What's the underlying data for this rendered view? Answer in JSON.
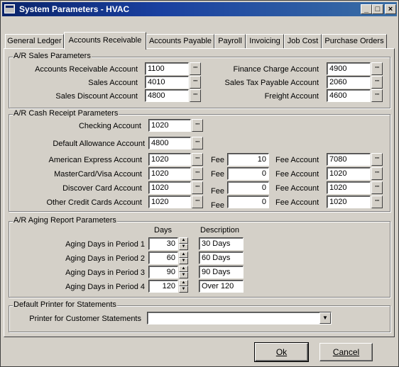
{
  "window": {
    "title": "System Parameters - HVAC",
    "min": "_",
    "max": "□",
    "close": "×"
  },
  "tabs": [
    "General Ledger",
    "Accounts Receivable",
    "Accounts Payable",
    "Payroll",
    "Invoicing",
    "Job Cost",
    "Purchase Orders"
  ],
  "sales": {
    "group": "A/R Sales Parameters",
    "ar_account_label": "Accounts Receivable Account",
    "ar_account": "1100",
    "sales_account_label": "Sales Account",
    "sales_account": "4010",
    "sales_discount_label": "Sales Discount Account",
    "sales_discount": "4800",
    "finance_charge_label": "Finance Charge Account",
    "finance_charge": "4900",
    "sales_tax_label": "Sales Tax Payable Account",
    "sales_tax": "2060",
    "freight_label": "Freight Account",
    "freight": "4600"
  },
  "cash": {
    "group": "A/R Cash Receipt Parameters",
    "checking_label": "Checking Account",
    "checking": "1020",
    "allowance_label": "Default Allowance Account",
    "allowance": "4800",
    "fee_label": "Fee",
    "fee_account_label": "Fee Account",
    "cards": [
      {
        "label": "American Express Account",
        "account": "1020",
        "fee": "10",
        "fee_account": "7080"
      },
      {
        "label": "MasterCard/Visa Account",
        "account": "1020",
        "fee": "0",
        "fee_account": "1020"
      },
      {
        "label": "Discover Card Account",
        "account": "1020",
        "fee": "0",
        "fee_account": "1020"
      },
      {
        "label": "Other Credit Cards Account",
        "account": "1020",
        "fee": "0",
        "fee_account": "1020"
      }
    ]
  },
  "aging": {
    "group": "A/R Aging Report Parameters",
    "days_header": "Days",
    "desc_header": "Description",
    "periods": [
      {
        "label": "Aging Days in Period 1",
        "days": "30",
        "desc": "30 Days"
      },
      {
        "label": "Aging Days in Period 2",
        "days": "60",
        "desc": "60 Days"
      },
      {
        "label": "Aging Days in Period 3",
        "days": "90",
        "desc": "90 Days"
      },
      {
        "label": "Aging Days in Period 4",
        "days": "120",
        "desc": "Over 120"
      }
    ]
  },
  "printer": {
    "group": "Default Printer for Statements",
    "label": "Printer for Customer Statements",
    "value": ""
  },
  "buttons": {
    "ok": "Ok",
    "cancel": "Cancel"
  },
  "lookup_glyph": "···"
}
